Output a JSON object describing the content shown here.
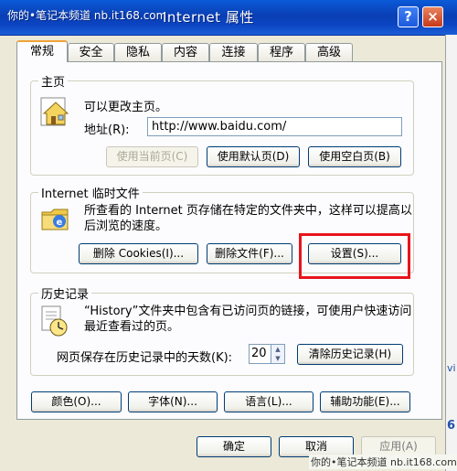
{
  "watermark": "你的•笔记本频道 nb.it168.com",
  "window": {
    "title": "Internet 属性",
    "help_label": "?",
    "close_label": "×"
  },
  "tabs": [
    {
      "label": "常规",
      "active": true
    },
    {
      "label": "安全"
    },
    {
      "label": "隐私"
    },
    {
      "label": "内容"
    },
    {
      "label": "连接"
    },
    {
      "label": "程序"
    },
    {
      "label": "高级"
    }
  ],
  "home": {
    "legend": "主页",
    "desc": "可以更改主页。",
    "address_label": "地址(R):",
    "address_value": "http://www.baidu.com/",
    "btn_current": "使用当前页(C)",
    "btn_default": "使用默认页(D)",
    "btn_blank": "使用空白页(B)"
  },
  "temp": {
    "legend": "Internet 临时文件",
    "desc": "所查看的 Internet 页存储在特定的文件夹中，这样可以提高以后浏览的速度。",
    "btn_cookies": "删除 Cookies(I)...",
    "btn_files": "删除文件(F)...",
    "btn_settings": "设置(S)..."
  },
  "history": {
    "legend": "历史记录",
    "desc": "“History”文件夹中包含有已访问页的链接，可使用户快速访问最近查看过的页。",
    "days_label": "网页保存在历史记录中的天数(K):",
    "days_value": "20",
    "btn_clear": "清除历史记录(H)"
  },
  "bottom": {
    "btn_colors": "颜色(O)...",
    "btn_fonts": "字体(N)...",
    "btn_languages": "语言(L)...",
    "btn_accessibility": "辅助功能(E)..."
  },
  "dialog": {
    "ok": "确定",
    "cancel": "取消",
    "apply": "应用(A)"
  },
  "footer_watermark": "你的•笔记本频道 nb.it168.com",
  "strip": {
    "item_1": "vi",
    "item_2": "6"
  }
}
